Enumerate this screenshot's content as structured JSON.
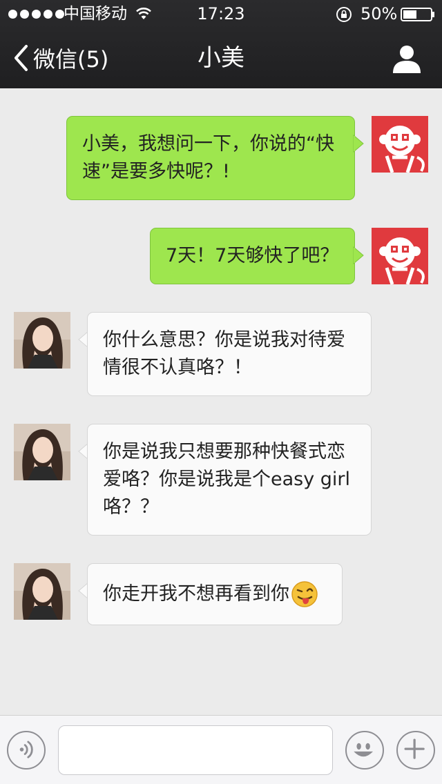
{
  "status_bar": {
    "carrier": "中国移动",
    "time": "17:23",
    "battery": "50%",
    "battery_level": 0.5
  },
  "nav": {
    "back_label": "微信(5)",
    "title": "小美",
    "back_icon": "chevron-left-icon",
    "right_icon": "person-icon"
  },
  "messages": [
    {
      "from": "me",
      "text": "小美，我想问一下，你说的“快速”是要多快呢？!"
    },
    {
      "from": "me",
      "text": "7天！7天够快了吧？"
    },
    {
      "from": "contact",
      "text": "你什么意思？你是说我对待爱情很不认真咯？！"
    },
    {
      "from": "contact",
      "text": "你是说我只想要那种快餐式恋爱咯？你是说我是个easy girl咯？？"
    },
    {
      "from": "contact",
      "text": "你走开我不想再看到你",
      "emoji": "tongue-out-face-emoji"
    }
  ],
  "input_bar": {
    "voice_icon": "voice-icon",
    "emoji_icon": "smiley-icon",
    "plus_icon": "plus-icon",
    "input_value": ""
  },
  "colors": {
    "header_bg": "#1f1f21",
    "outgoing_bubble": "#9ee64e",
    "incoming_bubble": "#fafafa",
    "chat_bg": "#ebebeb",
    "my_avatar_bg": "#e03a3e"
  }
}
